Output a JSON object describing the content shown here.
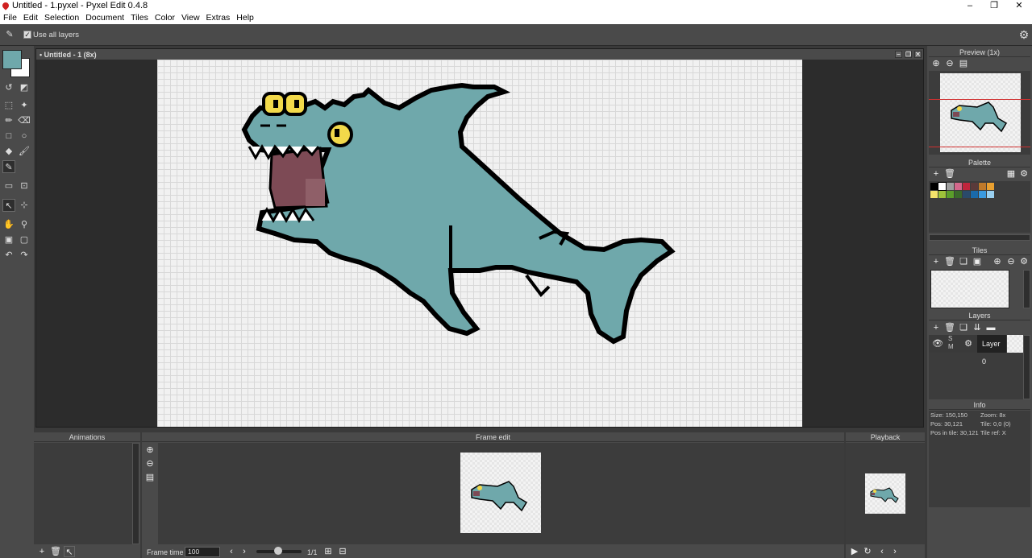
{
  "window": {
    "title": "Untitled - 1.pyxel - Pyxel Edit 0.4.8",
    "minimize": "–",
    "maximize": "❐",
    "close": "✕"
  },
  "menu": [
    "File",
    "Edit",
    "Selection",
    "Document",
    "Tiles",
    "Color",
    "View",
    "Extras",
    "Help"
  ],
  "tool_options": {
    "use_all_layers_label": "Use all layers",
    "use_all_layers_checked": "✓"
  },
  "colors": {
    "primary": "#6fa8ab",
    "secondary": "#ffffff",
    "accent": "#d02020"
  },
  "document": {
    "tab_label": "• Untitled - 1   (8x)"
  },
  "panels": {
    "preview": {
      "title": "Preview (1x)"
    },
    "palette": {
      "title": "Palette",
      "swatches_row1": [
        "#000000",
        "#ffffff",
        "#9e9e9e",
        "#d3678b",
        "#c1253c",
        "#5a3a3a",
        "#c07a2a",
        "#e9a030"
      ],
      "swatches_row2": [
        "#f5e36b",
        "#9ec33a",
        "#5a9e2a",
        "#3a6a2a",
        "#2a4a6a",
        "#1a6aaa",
        "#3a9ae0",
        "#9ad0f0"
      ]
    },
    "tiles": {
      "title": "Tiles"
    },
    "layers": {
      "title": "Layers",
      "layer_name": "Layer 0",
      "solo": "S",
      "mute": "M"
    },
    "info": {
      "title": "Info",
      "size": "Size: 150,150",
      "zoom": "Zoom: 8x",
      "pos": "Pos: 30,121",
      "tile": "Tile: 0,0 (0)",
      "pos_in_tile": "Pos in tile: 30,121",
      "tile_ref": "Tile ref: X"
    },
    "animations": {
      "title": "Animations"
    },
    "frame_edit": {
      "title": "Frame edit"
    },
    "playback": {
      "title": "Playback"
    }
  },
  "timeline": {
    "frame_time_label": "Frame time",
    "frame_time_value": "100",
    "frame_counter": "1/1"
  }
}
